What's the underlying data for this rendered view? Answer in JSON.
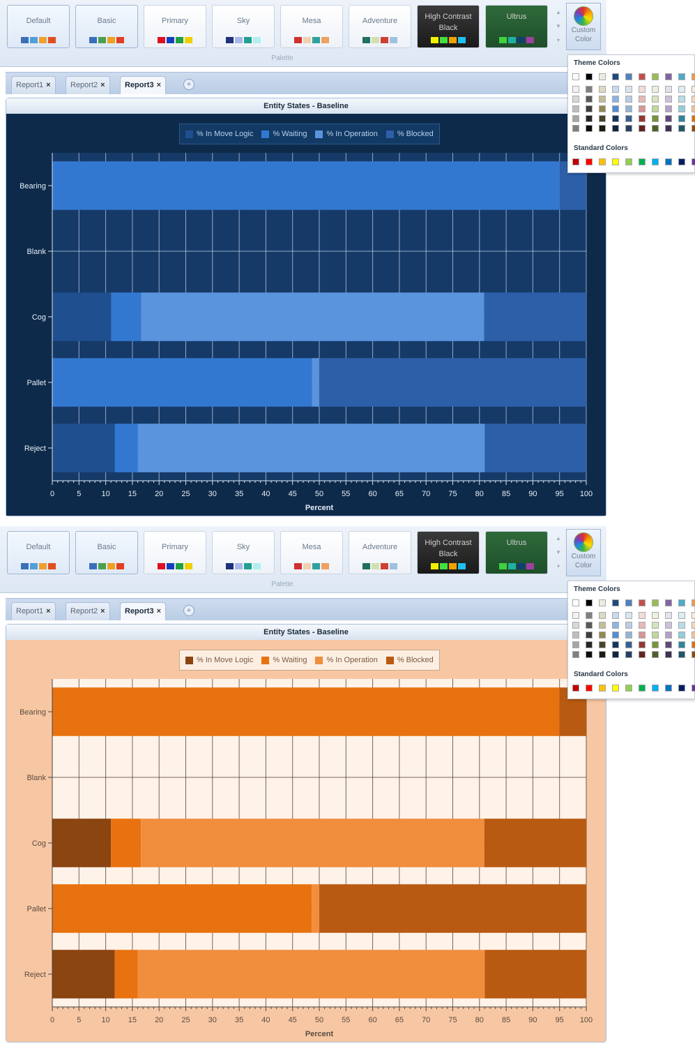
{
  "palettes": [
    {
      "name": "Default",
      "colors": [
        "#3b6fb5",
        "#4f9fd9",
        "#f0a030",
        "#e05020"
      ],
      "selected": true
    },
    {
      "name": "Basic",
      "colors": [
        "#3a6fb8",
        "#4aa050",
        "#f0a020",
        "#e04020"
      ],
      "selected": true
    },
    {
      "name": "Primary",
      "colors": [
        "#e01020",
        "#1040c0",
        "#20a040",
        "#f0d000"
      ]
    },
    {
      "name": "Sky",
      "colors": [
        "#20307a",
        "#a8b8e8",
        "#20a090",
        "#b0f0f0"
      ]
    },
    {
      "name": "Mesa",
      "colors": [
        "#d03030",
        "#f0d0b0",
        "#30a0a0",
        "#f0a060"
      ]
    },
    {
      "name": "Adventure",
      "colors": [
        "#207060",
        "#d0e0b0",
        "#d04030",
        "#a0c0e0"
      ]
    },
    {
      "name": "High Contrast Black",
      "colors": [
        "#f0f000",
        "#40e040",
        "#f0a000",
        "#20c0f0"
      ],
      "dark": true
    },
    {
      "name": "Ultrus",
      "colors": [
        "#40d040",
        "#20b0a0",
        "#104070",
        "#a040a0"
      ],
      "dark": true
    }
  ],
  "palette_group_label": "Palette",
  "custom_color_label": "Custom Color",
  "tabs": [
    {
      "label": "Report1"
    },
    {
      "label": "Report2"
    },
    {
      "label": "Report3",
      "active": true
    }
  ],
  "close_glyph": "×",
  "add_glyph": "+",
  "chart_title": "Entity States - Baseline",
  "popup": {
    "theme_colors_label": "Theme Colors",
    "standard_colors_label": "Standard Colors",
    "theme_top": [
      "#ffffff",
      "#000000",
      "#eeece1",
      "#1f497d",
      "#4f81bd",
      "#c0504d",
      "#9bbb59",
      "#8064a2",
      "#4bacc6",
      "#f79646"
    ],
    "theme_tints": [
      [
        "#f2f2f2",
        "#7f7f7f",
        "#ddd9c3",
        "#c6d9f0",
        "#dbe5f1",
        "#f2dcdb",
        "#ebf1dd",
        "#e5e0ec",
        "#dbeef3",
        "#fdeada"
      ],
      [
        "#d8d8d8",
        "#595959",
        "#c4bd97",
        "#8db3e2",
        "#b8cce4",
        "#e5b9b7",
        "#d7e3bc",
        "#ccc1d9",
        "#b7dde8",
        "#fbd5b5"
      ],
      [
        "#bfbfbf",
        "#3f3f3f",
        "#938953",
        "#548dd4",
        "#95b3d7",
        "#d99694",
        "#c3d69b",
        "#b2a2c7",
        "#92cddc",
        "#fac08f"
      ],
      [
        "#a5a5a5",
        "#262626",
        "#494429",
        "#17365d",
        "#366092",
        "#953734",
        "#76923c",
        "#5f497a",
        "#31859b",
        "#e36c09"
      ],
      [
        "#7f7f7f",
        "#0c0c0c",
        "#1d1b10",
        "#0f243e",
        "#244061",
        "#632423",
        "#4f6128",
        "#3f3151",
        "#205867",
        "#974806"
      ]
    ],
    "standard": [
      "#c00000",
      "#ff0000",
      "#ffc000",
      "#ffff00",
      "#92d050",
      "#00b050",
      "#00b0f0",
      "#0070c0",
      "#002060",
      "#7030a0"
    ]
  },
  "chart_data": [
    {
      "type": "bar",
      "orientation": "horizontal",
      "stacked": true,
      "theme": "blue",
      "title": "Entity States - Baseline",
      "xlabel": "Percent",
      "xlim": [
        0,
        100
      ],
      "x_ticks": [
        "0",
        "5",
        "10",
        "15",
        "20",
        "25",
        "30",
        "35",
        "40",
        "45",
        "50",
        "55",
        "60",
        "65",
        "70",
        "75",
        "80",
        "85",
        "90",
        "95",
        "100"
      ],
      "categories": [
        "Bearing",
        "Blank",
        "Cog",
        "Pallet",
        "Reject"
      ],
      "legend_position": "top-center",
      "series": [
        {
          "name": "% In Move Logic",
          "color": "#1f4f8f",
          "values": [
            0,
            0,
            11,
            0,
            11.7
          ]
        },
        {
          "name": "% Waiting",
          "color": "#3378d0",
          "values": [
            95,
            0,
            5.6,
            48.6,
            4.3
          ]
        },
        {
          "name": "% In Operation",
          "color": "#5a94dc",
          "values": [
            0,
            0,
            64.3,
            1.4,
            65
          ]
        },
        {
          "name": "% Blocked",
          "color": "#2c5fa8",
          "values": [
            5,
            0,
            19.1,
            50,
            19
          ]
        }
      ]
    },
    {
      "type": "bar",
      "orientation": "horizontal",
      "stacked": true,
      "theme": "orange",
      "title": "Entity States - Baseline",
      "xlabel": "Percent",
      "xlim": [
        0,
        100
      ],
      "x_ticks": [
        "0",
        "5",
        "10",
        "15",
        "20",
        "25",
        "30",
        "35",
        "40",
        "45",
        "50",
        "55",
        "60",
        "65",
        "70",
        "75",
        "80",
        "85",
        "90",
        "95",
        "100"
      ],
      "categories": [
        "Bearing",
        "Blank",
        "Cog",
        "Pallet",
        "Reject"
      ],
      "legend_position": "top-center",
      "series": [
        {
          "name": "% In Move Logic",
          "color": "#8b4510",
          "values": [
            0,
            0,
            11,
            0,
            11.7
          ]
        },
        {
          "name": "% Waiting",
          "color": "#e8720f",
          "values": [
            95,
            0,
            5.6,
            48.6,
            4.3
          ]
        },
        {
          "name": "% In Operation",
          "color": "#f08e3e",
          "values": [
            0,
            0,
            64.3,
            1.4,
            65
          ]
        },
        {
          "name": "% Blocked",
          "color": "#b85a12",
          "values": [
            5,
            0,
            19.1,
            50,
            19
          ]
        }
      ]
    }
  ]
}
